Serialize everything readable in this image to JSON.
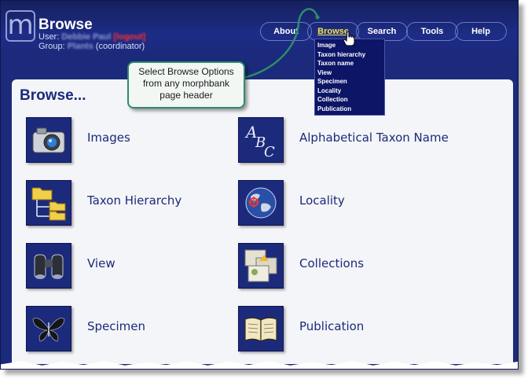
{
  "header": {
    "page_title": "Browse",
    "user_label": "User:",
    "user_name": "Debbie Paul",
    "logout": "[logout]",
    "group_label": "Group:",
    "group_name": "Plants",
    "group_role": "(coordinator)"
  },
  "nav": {
    "items": [
      {
        "label": "About"
      },
      {
        "label": "Browse"
      },
      {
        "label": "Search"
      },
      {
        "label": "Tools"
      },
      {
        "label": "Help"
      }
    ],
    "active": "Browse"
  },
  "dropdown": {
    "items": [
      {
        "label": "Image"
      },
      {
        "label": "Taxon hierarchy"
      },
      {
        "label": "Taxon name"
      },
      {
        "label": "View"
      },
      {
        "label": "Specimen"
      },
      {
        "label": "Locality"
      },
      {
        "label": "Collection"
      },
      {
        "label": "Publication"
      }
    ]
  },
  "callout": {
    "text": "Select Browse Options from any morphbank page header"
  },
  "main": {
    "title": "Browse...",
    "items": [
      {
        "label": "Images",
        "icon": "camera-icon"
      },
      {
        "label": "Alphabetical Taxon Name",
        "icon": "abc-letters-icon"
      },
      {
        "label": "Taxon Hierarchy",
        "icon": "folder-tree-icon"
      },
      {
        "label": "Locality",
        "icon": "globe-icon"
      },
      {
        "label": "View",
        "icon": "binoculars-icon"
      },
      {
        "label": "Collections",
        "icon": "collection-icon"
      },
      {
        "label": "Specimen",
        "icon": "butterfly-icon"
      },
      {
        "label": "Publication",
        "icon": "book-icon"
      }
    ]
  },
  "colors": {
    "header_bg": "#1b2a7a",
    "active_nav": "#f3e24a",
    "logout": "#ff3333",
    "callout_border": "#2e8b6c"
  }
}
